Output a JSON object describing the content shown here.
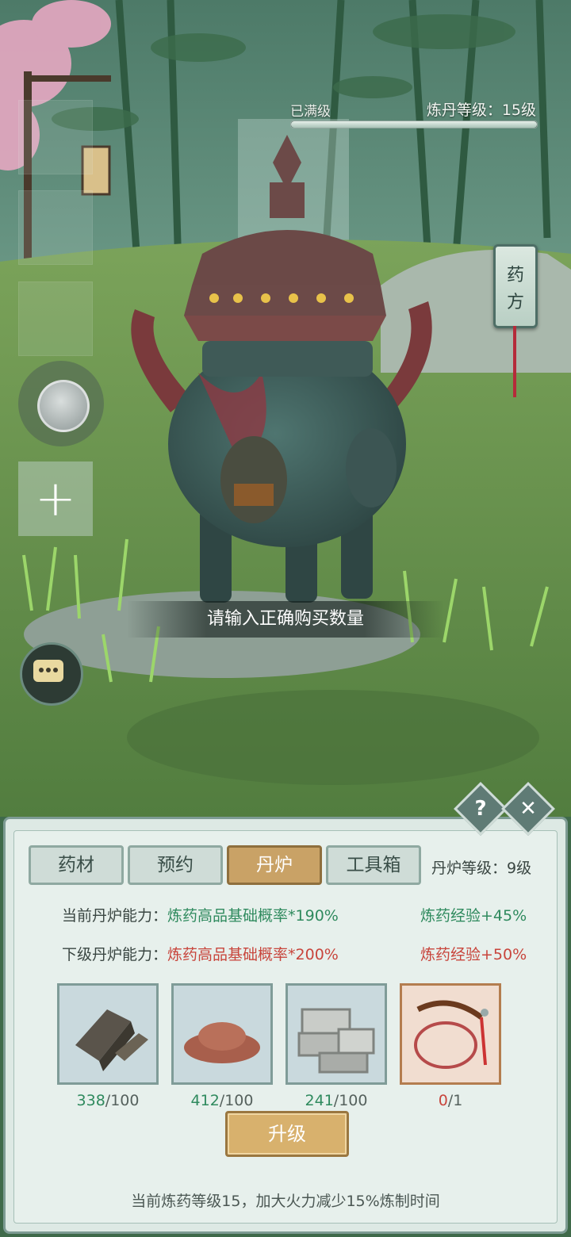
{
  "hud": {
    "level_status": "已满级",
    "alchemy_level": "炼丹等级：15级",
    "progress": 1.0,
    "recipe_tag": [
      "药",
      "方"
    ],
    "add_label": "+",
    "toast": "请输入正确购买数量"
  },
  "panel": {
    "help_label": "?",
    "close_label": "✕",
    "tabs": [
      "药材",
      "预约",
      "丹炉",
      "工具箱"
    ],
    "active_tab": "丹炉",
    "furnace_level": "丹炉等级：9级",
    "current": {
      "label": "当前丹炉能力：",
      "rate": "炼药高品基础概率*190%",
      "exp": "炼药经验+45%"
    },
    "next": {
      "label": "下级丹炉能力：",
      "rate": "炼药高品基础概率*200%",
      "exp": "炼药经验+50%"
    },
    "materials": [
      {
        "icon": "iron-ingot-icon",
        "have": "338",
        "need": "/100"
      },
      {
        "icon": "red-soil-icon",
        "have": "412",
        "need": "/100"
      },
      {
        "icon": "stone-brick-icon",
        "have": "241",
        "need": "/100"
      },
      {
        "icon": "whip-icon",
        "have": "0",
        "need": "/1"
      }
    ],
    "upgrade_label": "升级",
    "footer": "当前炼药等级15，加大火力减少15%炼制时间"
  },
  "colors": {
    "good": "#2f8a5e",
    "bad": "#c8453c",
    "accent": "#c9a266"
  }
}
